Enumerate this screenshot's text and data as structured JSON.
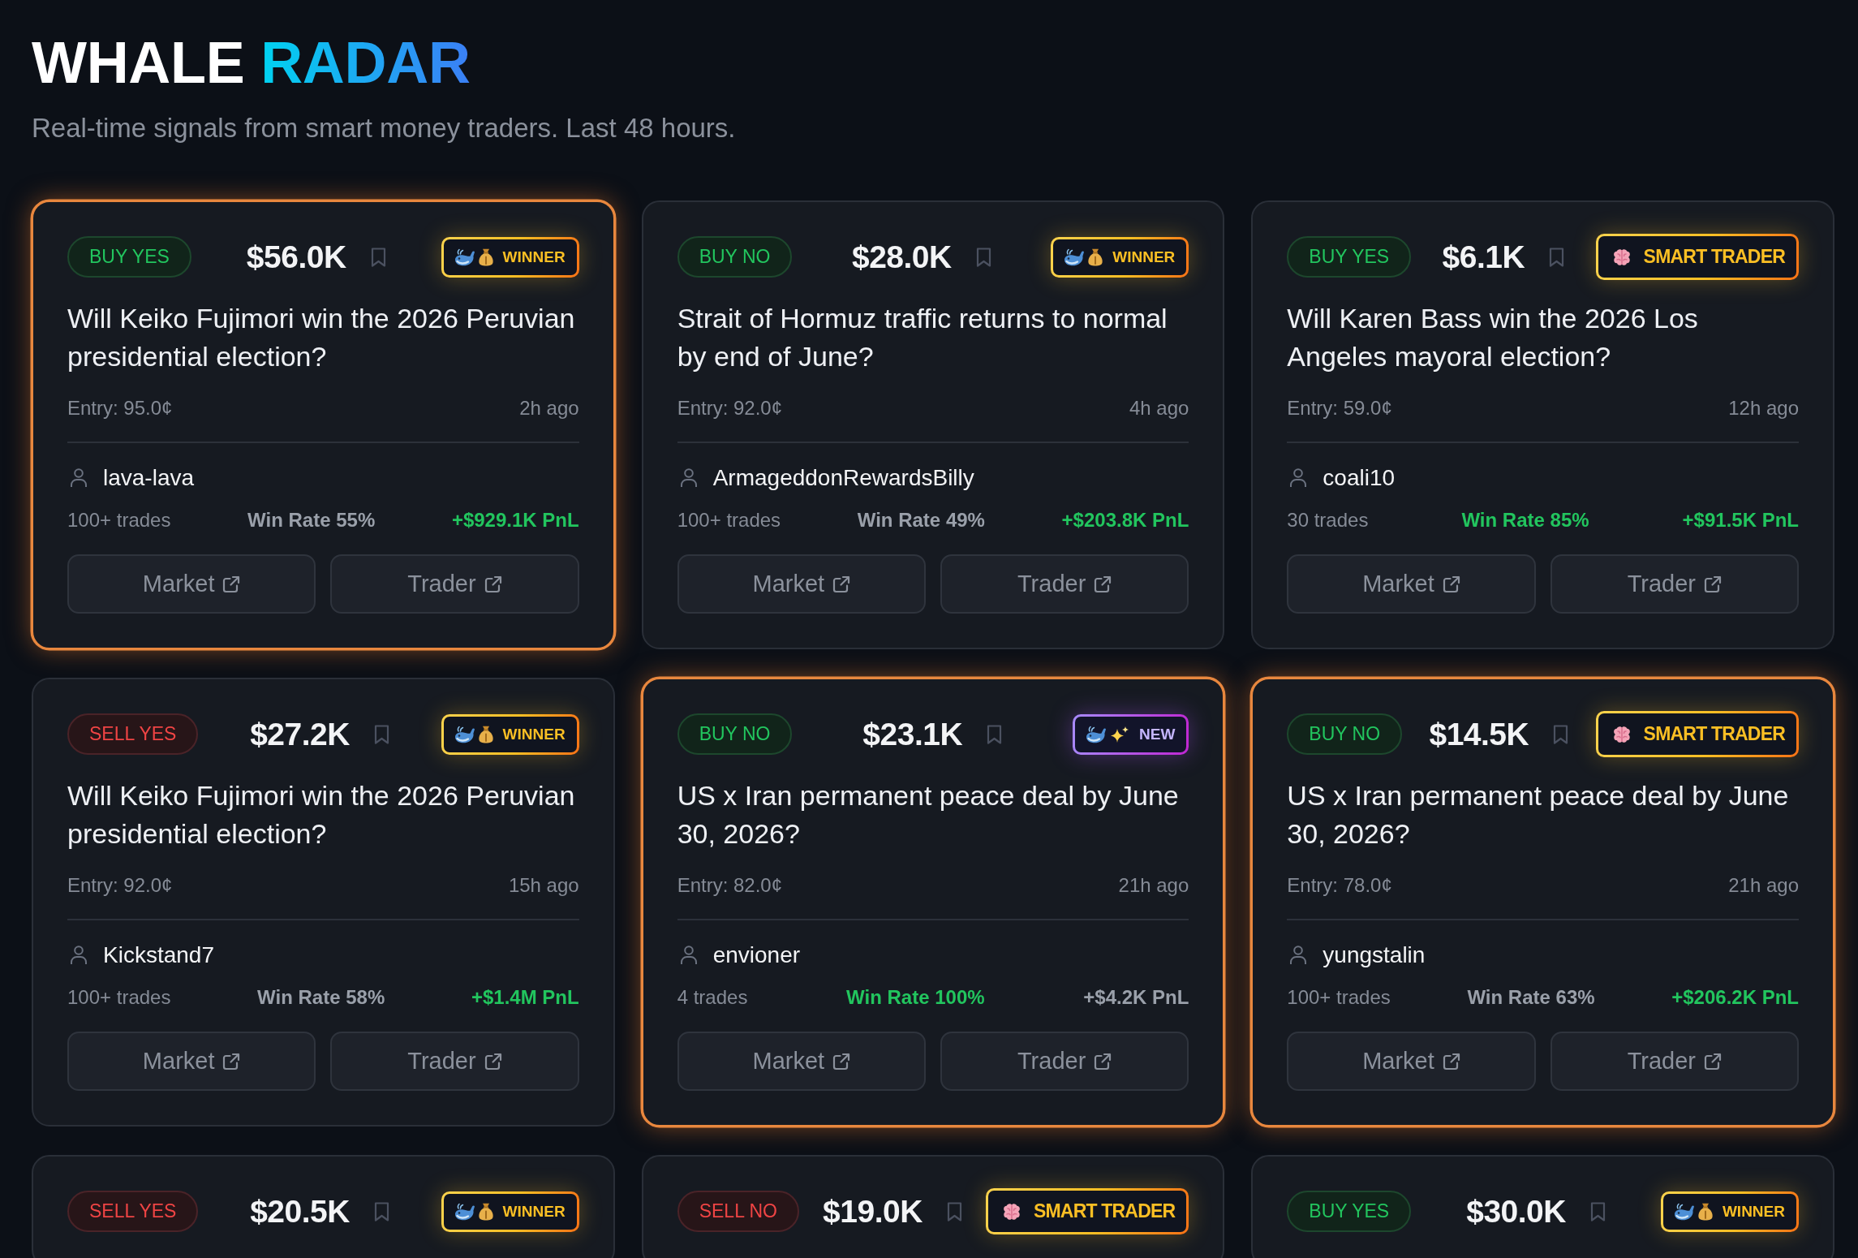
{
  "header": {
    "title": {
      "main": "WHALE",
      "accent": "RADAR"
    },
    "subtitle": "Real-time signals from smart money traders. Last 48 hours."
  },
  "signals": [
    {
      "highlighted": true,
      "side": {
        "label": "BUY YES",
        "kind": "buy"
      },
      "amount": "$56.0K",
      "badge": {
        "label": "WINNER",
        "kind": "winner"
      },
      "question": "Will Keiko Fujimori win the 2026 Peruvian presidential election?",
      "entry": "Entry: 95.0¢",
      "time": "2h ago",
      "trader": "lava-lava",
      "trades": "100+ trades",
      "win_rate": {
        "text": "Win Rate 55%",
        "highlighted": false
      },
      "pnl": {
        "text": "+$929.1K PnL",
        "highlighted": true
      },
      "buttons": [
        "Market",
        "Trader"
      ]
    },
    {
      "highlighted": false,
      "side": {
        "label": "BUY NO",
        "kind": "buy"
      },
      "amount": "$28.0K",
      "badge": {
        "label": "WINNER",
        "kind": "winner"
      },
      "question": "Strait of Hormuz traffic returns to normal by end of June?",
      "entry": "Entry: 92.0¢",
      "time": "4h ago",
      "trader": "ArmageddonRewardsBilly",
      "trades": "100+ trades",
      "win_rate": {
        "text": "Win Rate 49%",
        "highlighted": false
      },
      "pnl": {
        "text": "+$203.8K PnL",
        "highlighted": true
      },
      "buttons": [
        "Market",
        "Trader"
      ]
    },
    {
      "highlighted": false,
      "side": {
        "label": "BUY YES",
        "kind": "buy"
      },
      "amount": "$6.1K",
      "badge": {
        "label": "SMART TRADER",
        "kind": "smart_trader"
      },
      "question": "Will Karen Bass win the 2026 Los Angeles mayoral election?",
      "entry": "Entry: 59.0¢",
      "time": "12h ago",
      "trader": "coali10",
      "trades": "30 trades",
      "win_rate": {
        "text": "Win Rate 85%",
        "highlighted": true
      },
      "pnl": {
        "text": "+$91.5K PnL",
        "highlighted": true
      },
      "buttons": [
        "Market",
        "Trader"
      ]
    },
    {
      "highlighted": false,
      "side": {
        "label": "SELL YES",
        "kind": "sell"
      },
      "amount": "$27.2K",
      "badge": {
        "label": "WINNER",
        "kind": "winner"
      },
      "question": "Will Keiko Fujimori win the 2026 Peruvian presidential election?",
      "entry": "Entry: 92.0¢",
      "time": "15h ago",
      "trader": "Kickstand7",
      "trades": "100+ trades",
      "win_rate": {
        "text": "Win Rate 58%",
        "highlighted": false
      },
      "pnl": {
        "text": "+$1.4M PnL",
        "highlighted": true
      },
      "buttons": [
        "Market",
        "Trader"
      ]
    },
    {
      "highlighted": true,
      "side": {
        "label": "BUY NO",
        "kind": "buy"
      },
      "amount": "$23.1K",
      "badge": {
        "label": "NEW",
        "kind": "new"
      },
      "question": "US x Iran permanent peace deal by June 30, 2026?",
      "entry": "Entry: 82.0¢",
      "time": "21h ago",
      "trader": "envioner",
      "trades": "4 trades",
      "win_rate": {
        "text": "Win Rate 100%",
        "highlighted": true
      },
      "pnl": {
        "text": "+$4.2K PnL",
        "highlighted": false
      },
      "buttons": [
        "Market",
        "Trader"
      ]
    },
    {
      "highlighted": true,
      "side": {
        "label": "BUY NO",
        "kind": "buy"
      },
      "amount": "$14.5K",
      "badge": {
        "label": "SMART TRADER",
        "kind": "smart_trader"
      },
      "question": "US x Iran permanent peace deal by June 30, 2026?",
      "entry": "Entry: 78.0¢",
      "time": "21h ago",
      "trader": "yungstalin",
      "trades": "100+ trades",
      "win_rate": {
        "text": "Win Rate 63%",
        "highlighted": false
      },
      "pnl": {
        "text": "+$206.2K PnL",
        "highlighted": true
      },
      "buttons": [
        "Market",
        "Trader"
      ]
    },
    {
      "highlighted": false,
      "side": {
        "label": "SELL YES",
        "kind": "sell"
      },
      "amount": "$20.5K",
      "badge": {
        "label": "WINNER",
        "kind": "winner"
      }
    },
    {
      "highlighted": false,
      "side": {
        "label": "SELL NO",
        "kind": "sell"
      },
      "amount": "$19.0K",
      "badge": {
        "label": "SMART TRADER",
        "kind": "smart_trader"
      }
    },
    {
      "highlighted": false,
      "side": {
        "label": "BUY YES",
        "kind": "buy"
      },
      "amount": "$30.0K",
      "badge": {
        "label": "WINNER",
        "kind": "winner"
      }
    }
  ]
}
